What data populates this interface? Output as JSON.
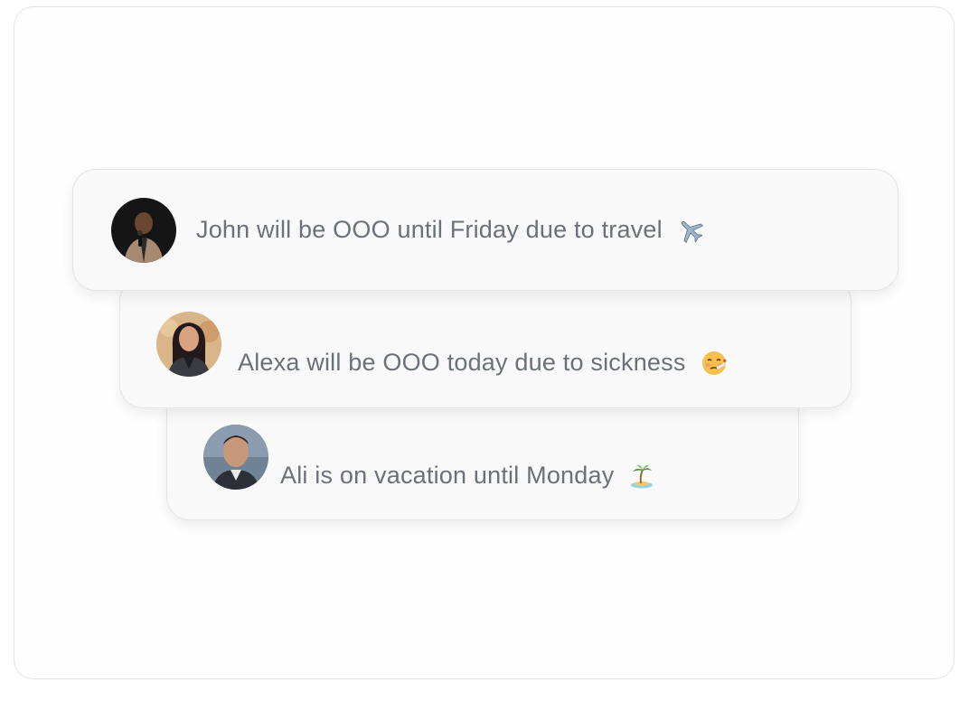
{
  "notifications": [
    {
      "name": "John",
      "message": "John will be OOO until Friday due to travel",
      "emoji": "airplane-icon"
    },
    {
      "name": "Alexa",
      "message": "Alexa will be OOO today due to sickness",
      "emoji": "sick-face-icon"
    },
    {
      "name": "Ali",
      "message": "Ali is on vacation until Monday",
      "emoji": "island-icon"
    }
  ]
}
